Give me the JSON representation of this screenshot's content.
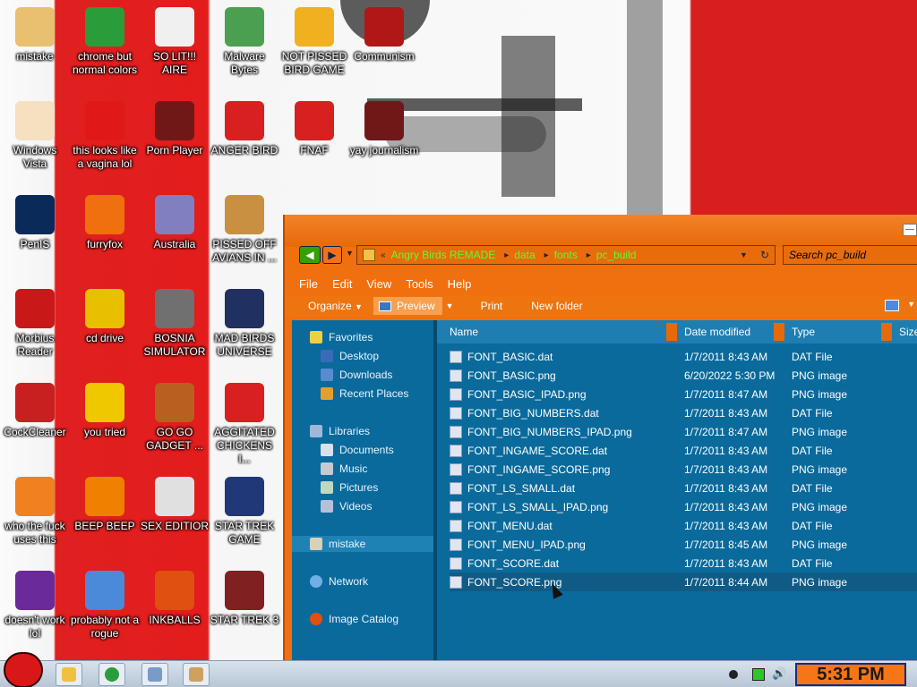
{
  "desktop": {
    "icons": [
      {
        "label": "mistake",
        "icon": "computer-icon",
        "color": "#e8c070"
      },
      {
        "label": "chrome but normal colors",
        "icon": "chrome-icon",
        "color": "#2a9d3a"
      },
      {
        "label": "SO LIT!!! AIRE",
        "icon": "solitaire-icon",
        "color": "#f0f0f0"
      },
      {
        "label": "Malware Bytes",
        "icon": "shield-icon",
        "color": "#4aa050"
      },
      {
        "label": "NOT PISSED BIRD GAME",
        "icon": "pig-icon",
        "color": "#f0b020"
      },
      {
        "label": "Communism",
        "icon": "symbol-icon",
        "color": "#b01818"
      },
      {
        "label": "Windows Vista",
        "icon": "egg-icon",
        "color": "#f5e0c0"
      },
      {
        "label": "this looks like a vagina lol",
        "icon": "opera-icon",
        "color": "#e01818"
      },
      {
        "label": "Porn Player",
        "icon": "flash-icon",
        "color": "#701818"
      },
      {
        "label": "ANGER BIRD",
        "icon": "bird-icon",
        "color": "#d82020"
      },
      {
        "label": "FNAF",
        "icon": "bird-icon",
        "color": "#d82020"
      },
      {
        "label": "yay journalism",
        "icon": "flash-icon",
        "color": "#701818"
      },
      {
        "label": "PenIS",
        "icon": "photoshop-icon",
        "color": "#0a2a5a"
      },
      {
        "label": "furryfox",
        "icon": "firefox-icon",
        "color": "#f07010"
      },
      {
        "label": "Australia",
        "icon": "gift-icon",
        "color": "#8080c0"
      },
      {
        "label": "PISSED OFF AVIANS IN ...",
        "icon": "seasons-icon",
        "color": "#c89040"
      },
      {
        "label": "Morbius Reader",
        "icon": "pdf-icon",
        "color": "#c81818"
      },
      {
        "label": "cd drive",
        "icon": "cd-icon",
        "color": "#e8c000"
      },
      {
        "label": "BOSNIA SIMULATOR",
        "icon": "mine-icon",
        "color": "#707070"
      },
      {
        "label": "MAD BIRDS UNIVERSE",
        "icon": "space-icon",
        "color": "#203060"
      },
      {
        "label": "CockCleaner",
        "icon": "ccleaner-icon",
        "color": "#c82020"
      },
      {
        "label": "you tried",
        "icon": "star-icon",
        "color": "#f0c800"
      },
      {
        "label": "GO GO GADGET ...",
        "icon": "briefcase-icon",
        "color": "#b86020"
      },
      {
        "label": "AGGITATED CHICKENS I...",
        "icon": "bird-icon",
        "color": "#d82020"
      },
      {
        "label": "who the fuck uses this",
        "icon": "winamp-icon",
        "color": "#f08020"
      },
      {
        "label": "BEEP BEEP",
        "icon": "vlc-icon",
        "color": "#f08000"
      },
      {
        "label": "SEX EDITIOR",
        "icon": "hxd-icon",
        "color": "#e0e0e0"
      },
      {
        "label": "STAR TREK GAME",
        "icon": "startrek-icon",
        "color": "#203878"
      },
      {
        "label": "doesn't work lol",
        "icon": "yahoo-icon",
        "color": "#6a2a9a"
      },
      {
        "label": "probably not a rogue",
        "icon": "settings-icon",
        "color": "#4a8ad8"
      },
      {
        "label": "INKBALLS",
        "icon": "inkball-icon",
        "color": "#e05010"
      },
      {
        "label": "STAR TREK 3",
        "icon": "startrek-icon",
        "color": "#802020"
      }
    ]
  },
  "explorer": {
    "breadcrumb": [
      "Angry Birds REMADE",
      "data",
      "fonts",
      "pc_build"
    ],
    "search_placeholder": "Search pc_build",
    "menus": [
      "File",
      "Edit",
      "View",
      "Tools",
      "Help"
    ],
    "toolbar": {
      "organize": "Organize",
      "preview": "Preview",
      "print": "Print",
      "new_folder": "New folder"
    },
    "nav": {
      "favorites": "Favorites",
      "desktop": "Desktop",
      "downloads": "Downloads",
      "recent_places": "Recent Places",
      "libraries": "Libraries",
      "documents": "Documents",
      "music": "Music",
      "pictures": "Pictures",
      "videos": "Videos",
      "mistake": "mistake",
      "network": "Network",
      "image_catalog": "Image Catalog"
    },
    "columns": {
      "name": "Name",
      "date": "Date modified",
      "type": "Type",
      "size": "Size"
    },
    "files": [
      {
        "name": "FONT_BASIC.dat",
        "date": "1/7/2011 8:43 AM",
        "type": "DAT File"
      },
      {
        "name": "FONT_BASIC.png",
        "date": "6/20/2022 5:30 PM",
        "type": "PNG image"
      },
      {
        "name": "FONT_BASIC_IPAD.png",
        "date": "1/7/2011 8:47 AM",
        "type": "PNG image"
      },
      {
        "name": "FONT_BIG_NUMBERS.dat",
        "date": "1/7/2011 8:43 AM",
        "type": "DAT File"
      },
      {
        "name": "FONT_BIG_NUMBERS_IPAD.png",
        "date": "1/7/2011 8:47 AM",
        "type": "PNG image"
      },
      {
        "name": "FONT_INGAME_SCORE.dat",
        "date": "1/7/2011 8:43 AM",
        "type": "DAT File"
      },
      {
        "name": "FONT_INGAME_SCORE.png",
        "date": "1/7/2011 8:43 AM",
        "type": "PNG image"
      },
      {
        "name": "FONT_LS_SMALL.dat",
        "date": "1/7/2011 8:43 AM",
        "type": "DAT File"
      },
      {
        "name": "FONT_LS_SMALL_IPAD.png",
        "date": "1/7/2011 8:43 AM",
        "type": "PNG image"
      },
      {
        "name": "FONT_MENU.dat",
        "date": "1/7/2011 8:43 AM",
        "type": "DAT File"
      },
      {
        "name": "FONT_MENU_IPAD.png",
        "date": "1/7/2011 8:45 AM",
        "type": "PNG image"
      },
      {
        "name": "FONT_SCORE.dat",
        "date": "1/7/2011 8:43 AM",
        "type": "DAT File"
      },
      {
        "name": "FONT_SCORE.png",
        "date": "1/7/2011 8:44 AM",
        "type": "PNG image"
      }
    ],
    "selected_file": "FONT_SCORE.png"
  },
  "taskbar": {
    "clock": "5:31 PM",
    "pinned": [
      {
        "icon": "folder-icon",
        "color": "#f0c040"
      },
      {
        "icon": "chrome-icon",
        "color": "#2a9d3a"
      },
      {
        "icon": "notepad-icon",
        "color": "#7a9ac8"
      },
      {
        "icon": "paint-icon",
        "color": "#d0a060"
      }
    ]
  },
  "colors": {
    "window_orange": "#f07010",
    "pane_blue": "#0a6a9c",
    "address_text_green": "#5cff30",
    "clock_bg": "#f47616"
  }
}
